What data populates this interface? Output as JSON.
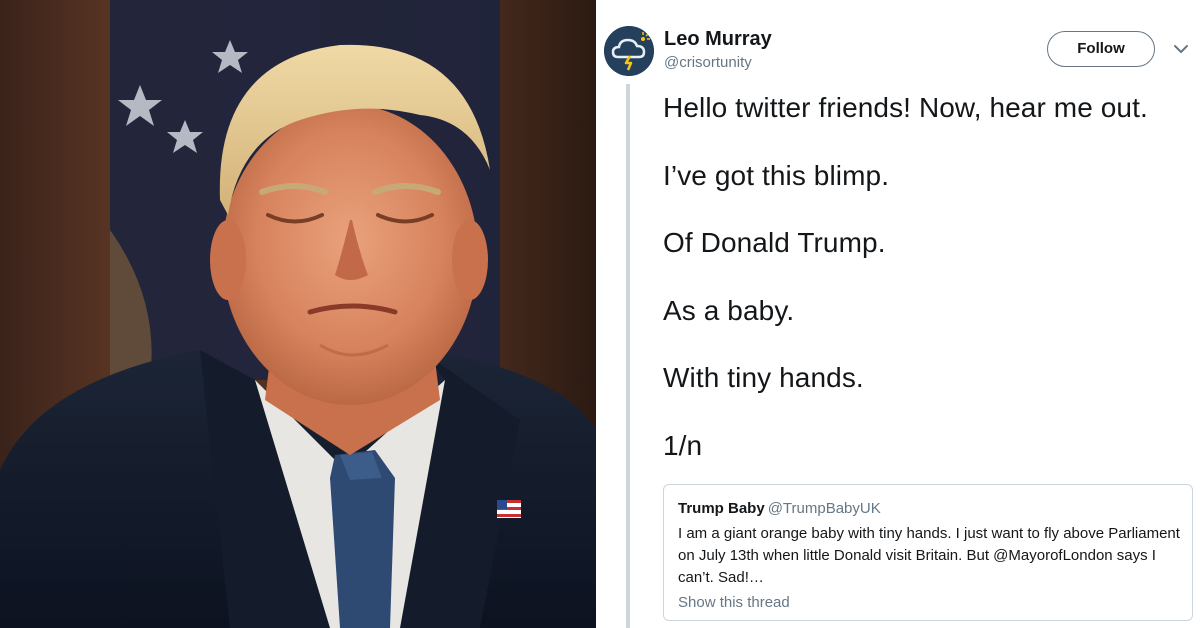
{
  "tweet": {
    "author": {
      "display_name": "Leo Murray",
      "handle": "@crisortunity",
      "avatar_icon": "storm-cloud-icon"
    },
    "follow_label": "Follow",
    "menu_icon": "chevron-down-icon",
    "lines": [
      "Hello twitter friends! Now, hear me out.",
      "I’ve got this blimp.",
      "Of Donald Trump.",
      "As a baby.",
      "With tiny hands.",
      "1/n"
    ],
    "quoted": {
      "display_name": "Trump Baby",
      "handle": "@TrumpBabyUK",
      "text": "I am a giant orange baby with tiny hands. I just want to fly above Parliament on July 13th when little Donald visit Britain. But @MayorofLondon says I can’t. Sad!…",
      "link_label": "Show this thread"
    }
  },
  "photo": {
    "subject": "man in dark suit with eyes closed, flag pin on lapel"
  },
  "colors": {
    "text_primary": "#14171a",
    "text_secondary": "#657786",
    "border": "#ccd6dd"
  }
}
